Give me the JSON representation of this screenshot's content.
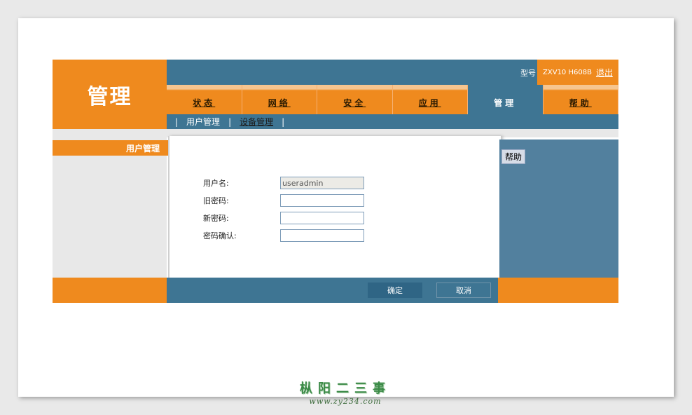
{
  "brand": {
    "title": "管理"
  },
  "header": {
    "model_label": "型号",
    "model_value": "ZXV10 H608B",
    "logout_label": "退出"
  },
  "tabs": [
    {
      "label": "状态",
      "active": false
    },
    {
      "label": "网络",
      "active": false
    },
    {
      "label": "安全",
      "active": false
    },
    {
      "label": "应用",
      "active": false
    },
    {
      "label": "管理",
      "active": true
    },
    {
      "label": "帮助",
      "active": false
    }
  ],
  "subnav": {
    "items": [
      {
        "label": "用户管理",
        "current": true
      },
      {
        "label": "设备管理",
        "current": false
      }
    ],
    "separator": "|"
  },
  "sidebar": {
    "items": [
      {
        "label": "用户管理",
        "active": true
      }
    ]
  },
  "help": {
    "label": "帮助"
  },
  "form": {
    "username_label": "用户名:",
    "username_value": "useradmin",
    "old_password_label": "旧密码:",
    "old_password_value": "",
    "new_password_label": "新密码:",
    "new_password_value": "",
    "confirm_password_label": "密码确认:",
    "confirm_password_value": ""
  },
  "footer": {
    "ok_label": "确定",
    "cancel_label": "取消"
  },
  "watermark": {
    "cn": "枞阳二三事",
    "url": "www.zy234.com"
  },
  "colors": {
    "orange": "#ef8a1e",
    "steel_blue": "#3e7593",
    "help_blue": "#52809e"
  }
}
